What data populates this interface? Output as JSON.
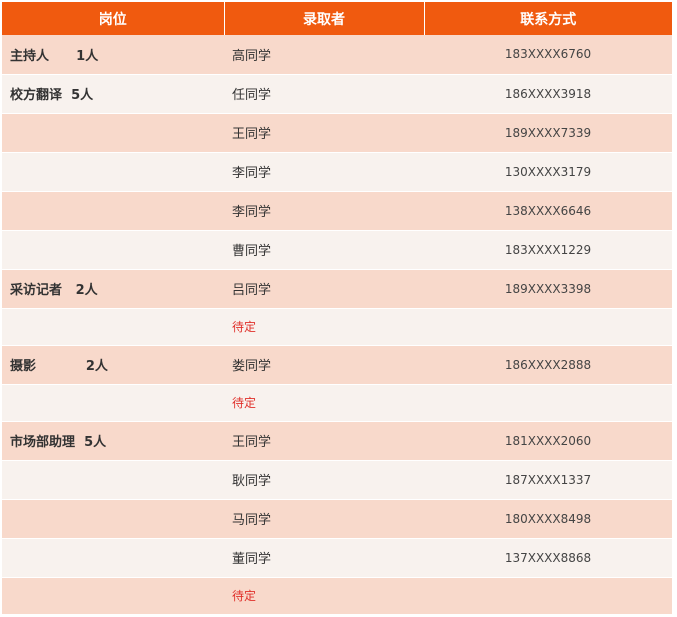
{
  "table": {
    "headers": [
      "岗位",
      "录取者",
      "联系方式"
    ],
    "rows": [
      {
        "position": "主持人",
        "count": "1人",
        "name": "高同学",
        "phone": "183XXXX6760"
      },
      {
        "position": "校方翻译",
        "count": "5人",
        "name": "任同学",
        "phone": "186XXXX3918"
      },
      {
        "position": "",
        "count": "",
        "name": "王同学",
        "phone": "189XXXX7339"
      },
      {
        "position": "",
        "count": "",
        "name": "李同学",
        "phone": "130XXXX3179"
      },
      {
        "position": "",
        "count": "",
        "name": "李同学",
        "phone": "138XXXX6646"
      },
      {
        "position": "",
        "count": "",
        "name": "曹同学",
        "phone": "183XXXX1229"
      },
      {
        "position": "采访记者",
        "count": "2人",
        "name": "吕同学",
        "phone": "189XXXX3398"
      },
      {
        "position": "",
        "count": "",
        "name": "待定",
        "phone": "",
        "pending": true
      },
      {
        "position": "摄影",
        "count": "2人",
        "name": "娄同学",
        "phone": "186XXXX2888"
      },
      {
        "position": "",
        "count": "",
        "name": "待定",
        "phone": "",
        "pending": true
      },
      {
        "position": "市场部助理",
        "count": "5人",
        "name": "王同学",
        "phone": "181XXXX2060"
      },
      {
        "position": "",
        "count": "",
        "name": "耿同学",
        "phone": "187XXXX1337"
      },
      {
        "position": "",
        "count": "",
        "name": "马同学",
        "phone": "180XXXX8498"
      },
      {
        "position": "",
        "count": "",
        "name": "董同学",
        "phone": "137XXXX8868"
      },
      {
        "position": "",
        "count": "",
        "name": "待定",
        "phone": "",
        "pending": true
      }
    ]
  },
  "colors": {
    "header_bg": "#f05a0f",
    "row_odd": "#f8d9cb",
    "row_even": "#f8f2ee",
    "pending_text": "#e0302a"
  }
}
